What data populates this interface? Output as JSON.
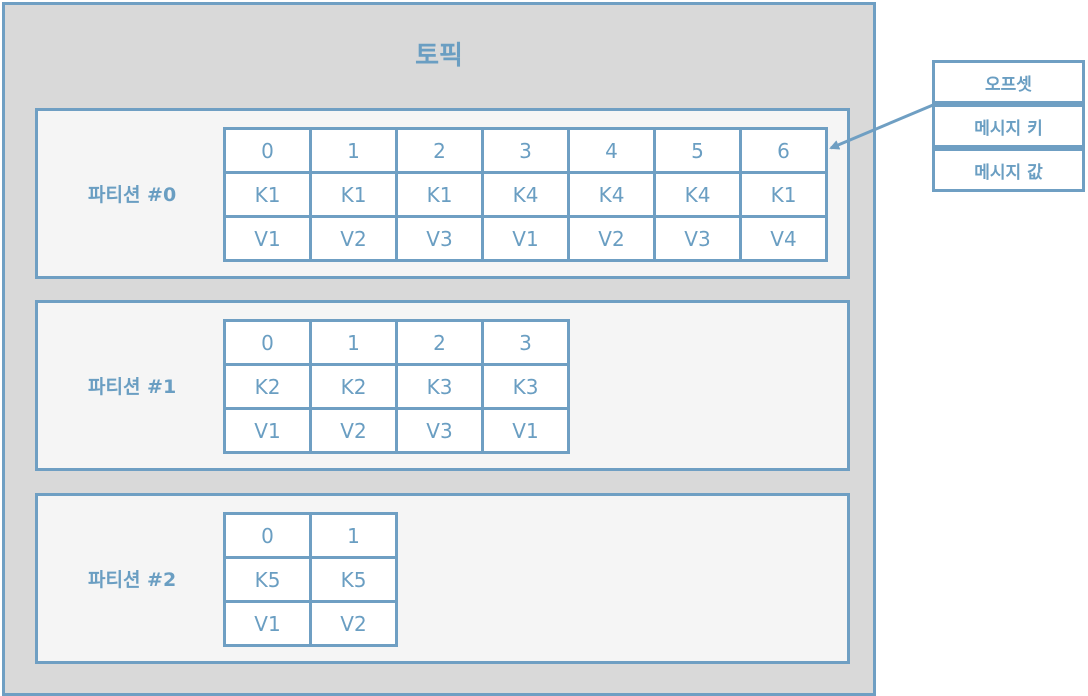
{
  "topic": {
    "title": "토픽"
  },
  "partitions": [
    {
      "label": "파티션 #0",
      "offsets": [
        "0",
        "1",
        "2",
        "3",
        "4",
        "5",
        "6"
      ],
      "keys": [
        "K1",
        "K1",
        "K1",
        "K4",
        "K4",
        "K4",
        "K1"
      ],
      "values": [
        "V1",
        "V2",
        "V3",
        "V1",
        "V2",
        "V3",
        "V4"
      ]
    },
    {
      "label": "파티션 #1",
      "offsets": [
        "0",
        "1",
        "2",
        "3"
      ],
      "keys": [
        "K2",
        "K2",
        "K3",
        "K3"
      ],
      "values": [
        "V1",
        "V2",
        "V3",
        "V1"
      ]
    },
    {
      "label": "파티션 #2",
      "offsets": [
        "0",
        "1"
      ],
      "keys": [
        "K5",
        "K5"
      ],
      "values": [
        "V1",
        "V2"
      ]
    }
  ],
  "legend": {
    "offset": "오프셋",
    "message_key": "메시지 키",
    "message_value": "메시지 값"
  },
  "colors": {
    "border": "#6f9fc3",
    "text": "#6a9ec2",
    "topic_bg": "#d9d9d9",
    "partition_bg": "#f5f5f5"
  }
}
